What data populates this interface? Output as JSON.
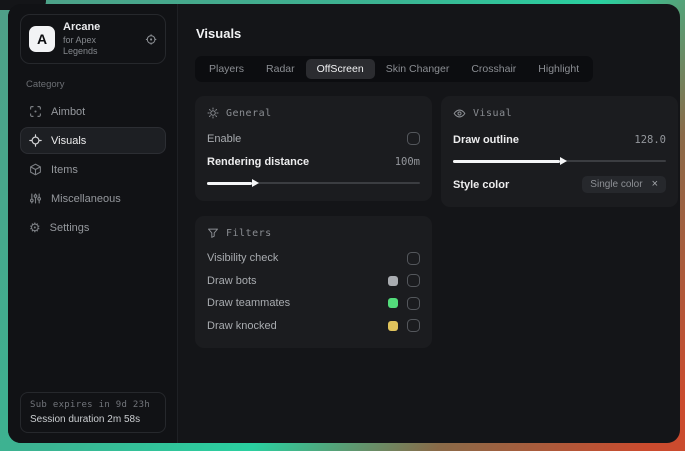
{
  "sidebar": {
    "logo_letter": "A",
    "app_name": "Arcane",
    "app_subtitle": "for Apex Legends",
    "category_label": "Category",
    "items": [
      {
        "label": "Aimbot"
      },
      {
        "label": "Visuals"
      },
      {
        "label": "Items"
      },
      {
        "label": "Miscellaneous"
      },
      {
        "label": "Settings"
      }
    ],
    "footer": {
      "expires": "Sub expires in 9d 23h",
      "session": "Session duration 2m 58s"
    }
  },
  "main": {
    "title": "Visuals",
    "selected_tab": "OffScreen",
    "tabs": [
      {
        "label": "Players"
      },
      {
        "label": "Radar"
      },
      {
        "label": "OffScreen"
      },
      {
        "label": "Skin Changer"
      },
      {
        "label": "Crosshair"
      },
      {
        "label": "Highlight"
      }
    ],
    "general": {
      "title": "General",
      "enable_label": "Enable",
      "distance_label": "Rendering distance",
      "distance_value": "100m",
      "distance_percent": 21
    },
    "visual": {
      "title": "Visual",
      "outline_label": "Draw outline",
      "outline_value": "128.0",
      "outline_percent": 50,
      "style_label": "Style color",
      "style_value": "Single color",
      "style_clear": "×"
    },
    "filters": {
      "title": "Filters",
      "rows": [
        {
          "label": "Visibility check",
          "swatch": null
        },
        {
          "label": "Draw bots",
          "swatch": "#a9acb0"
        },
        {
          "label": "Draw teammates",
          "swatch": "#53dc7b"
        },
        {
          "label": "Draw knocked",
          "swatch": "#e0c35c"
        }
      ]
    }
  },
  "colors": {
    "accent_teal": "#2ad0a0",
    "accent_red": "#cb4b2e",
    "window_bg": "#141518",
    "card_bg": "#1b1c1f"
  }
}
